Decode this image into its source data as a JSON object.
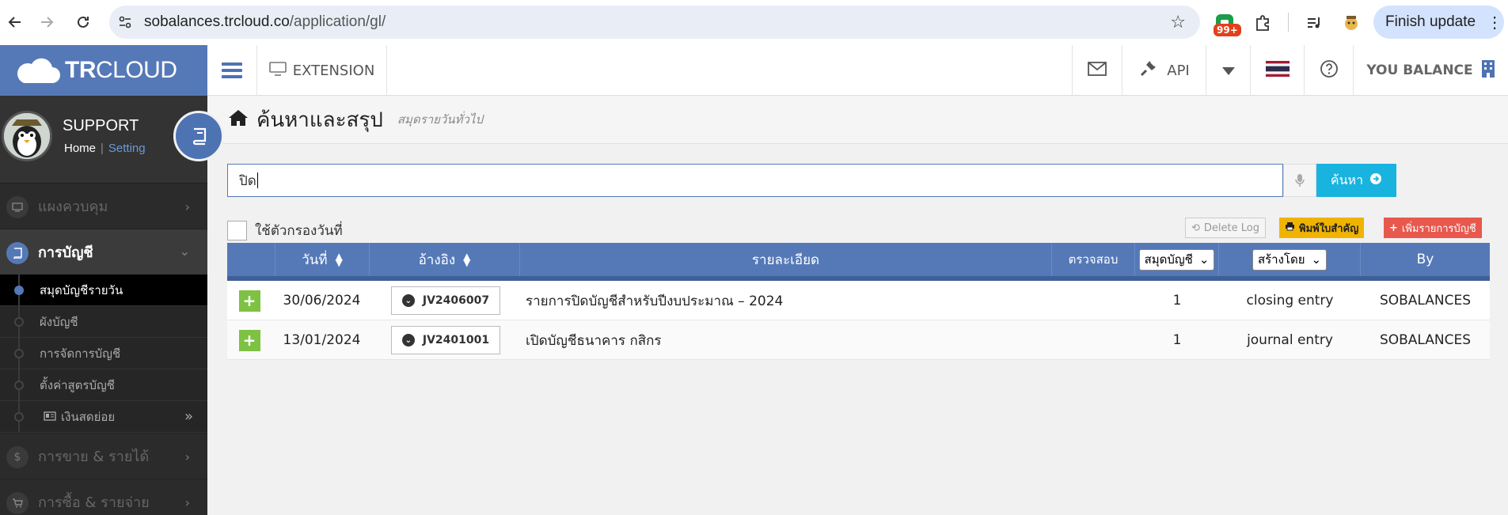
{
  "browser": {
    "url_domain": "sobalances.trcloud.co",
    "url_path": "/application/gl/",
    "ext_badge": "99+",
    "finish_update": "Finish update"
  },
  "brand": {
    "logo_bold": "TR",
    "logo_rest": "CLOUD"
  },
  "topbar": {
    "extension": "EXTENSION",
    "api": "API",
    "company": "YOU BALANCE"
  },
  "profile": {
    "name": "SUPPORT",
    "home": "Home",
    "setting": "Setting"
  },
  "sidebar": {
    "items": [
      {
        "label": "แผงควบคุม",
        "icon": "monitor-icon"
      },
      {
        "label": "การบัญชี",
        "icon": "book-icon"
      },
      {
        "label": "การขาย & รายได้",
        "icon": "dollar-icon"
      },
      {
        "label": "การซื้อ & รายจ่าย",
        "icon": "cart-icon"
      }
    ],
    "subitems": [
      {
        "label": "สมุดบัญชีรายวัน"
      },
      {
        "label": "ผังบัญชี"
      },
      {
        "label": "การจัดการบัญชี"
      },
      {
        "label": "ตั้งค่าสูตรบัญชี"
      },
      {
        "label": "เงินสดย่อย"
      }
    ]
  },
  "page": {
    "title": "ค้นหาและสรุป",
    "subtitle": "สมุดรายวันทั่วไป"
  },
  "search": {
    "value": "ปิด",
    "button": "ค้นหา"
  },
  "filter": {
    "date_label": "ใช้ตัวกรองวันที่"
  },
  "actions": {
    "delete_log": "Delete Log",
    "print": "พิมพ์ใบสำคัญ",
    "add": "เพิ่มรายการบัญชี"
  },
  "table": {
    "headers": {
      "date": "วันที่",
      "ref": "อ้างอิง",
      "detail": "รายละเอียด",
      "check": "ตรวจสอบ",
      "book_select": "สมุดบัญชี",
      "created_select": "สร้างโดย",
      "by": "By"
    },
    "rows": [
      {
        "date": "30/06/2024",
        "ref": "JV2406007",
        "detail": "รายการปิดบัญชีสำหรับปีงบประมาณ – 2024",
        "book": "1",
        "created": "closing entry",
        "by": "SOBALANCES"
      },
      {
        "date": "13/01/2024",
        "ref": "JV2401001",
        "detail": "เปิดบัญชีธนาคาร กสิกร",
        "book": "1",
        "created": "journal entry",
        "by": "SOBALANCES"
      }
    ]
  }
}
